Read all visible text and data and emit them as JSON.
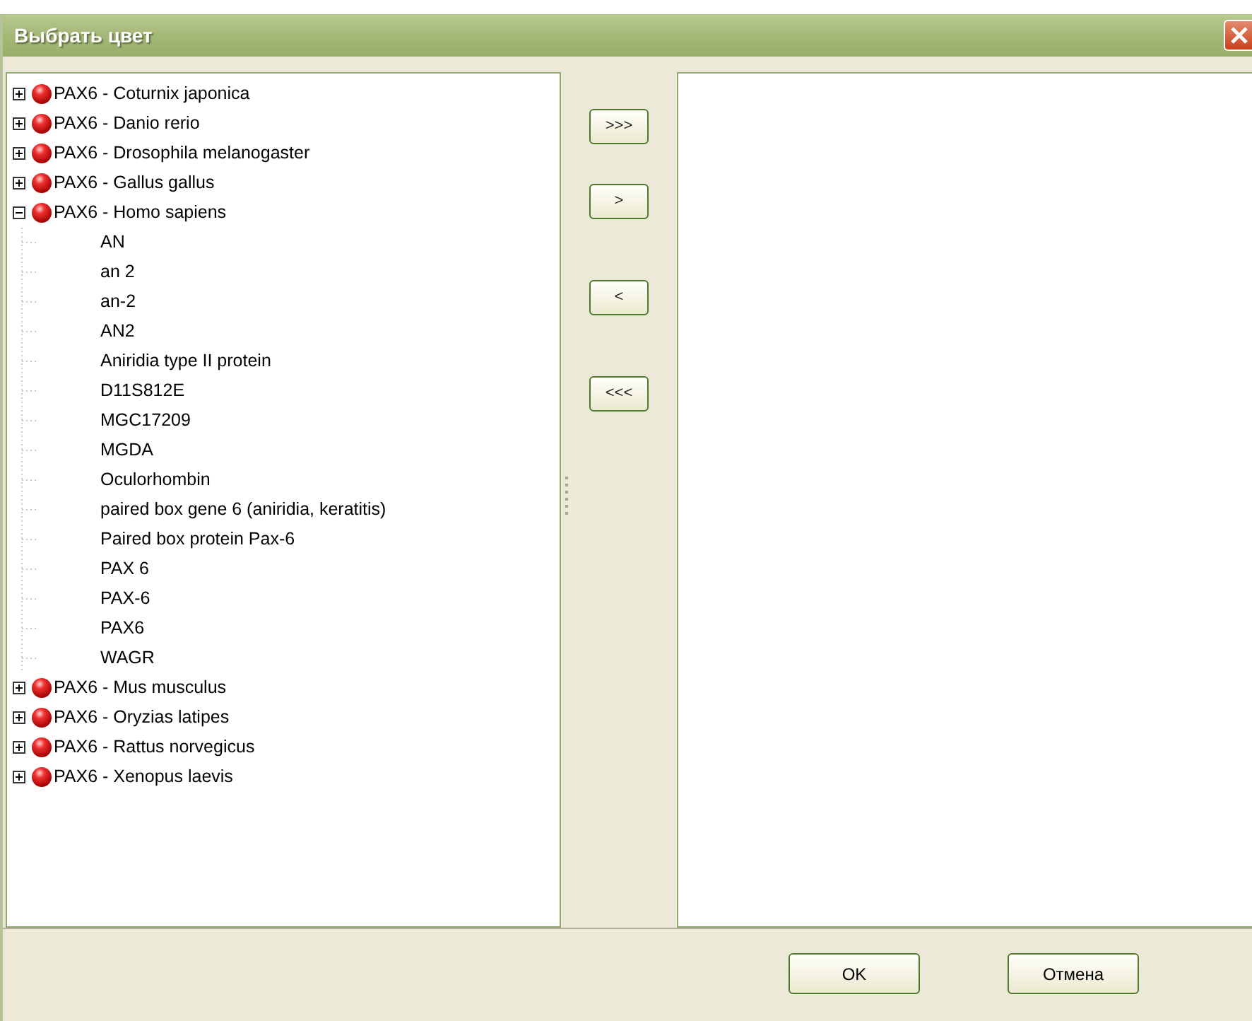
{
  "window": {
    "title": "Выбрать цвет"
  },
  "tree": [
    {
      "label": "PAX6 - Coturnix japonica",
      "expanded": false
    },
    {
      "label": "PAX6 - Danio rerio",
      "expanded": false
    },
    {
      "label": "PAX6 - Drosophila melanogaster",
      "expanded": false
    },
    {
      "label": "PAX6 - Gallus gallus",
      "expanded": false
    },
    {
      "label": "PAX6 - Homo sapiens",
      "expanded": true,
      "children": [
        {
          "label": "AN"
        },
        {
          "label": "an 2"
        },
        {
          "label": "an-2"
        },
        {
          "label": "AN2"
        },
        {
          "label": "Aniridia type II protein"
        },
        {
          "label": "D11S812E"
        },
        {
          "label": "MGC17209"
        },
        {
          "label": "MGDA"
        },
        {
          "label": "Oculorhombin"
        },
        {
          "label": "paired box gene 6 (aniridia, keratitis)"
        },
        {
          "label": "Paired box protein Pax-6"
        },
        {
          "label": "PAX 6"
        },
        {
          "label": "PAX-6"
        },
        {
          "label": "PAX6"
        },
        {
          "label": "WAGR"
        }
      ]
    },
    {
      "label": "PAX6 - Mus musculus",
      "expanded": false
    },
    {
      "label": "PAX6 - Oryzias latipes",
      "expanded": false
    },
    {
      "label": "PAX6 - Rattus norvegicus",
      "expanded": false
    },
    {
      "label": "PAX6 - Xenopus laevis",
      "expanded": false
    }
  ],
  "move_buttons": [
    ">>>",
    ">",
    "<",
    "<<<"
  ],
  "buttons": [
    "OK",
    "Отмена"
  ]
}
